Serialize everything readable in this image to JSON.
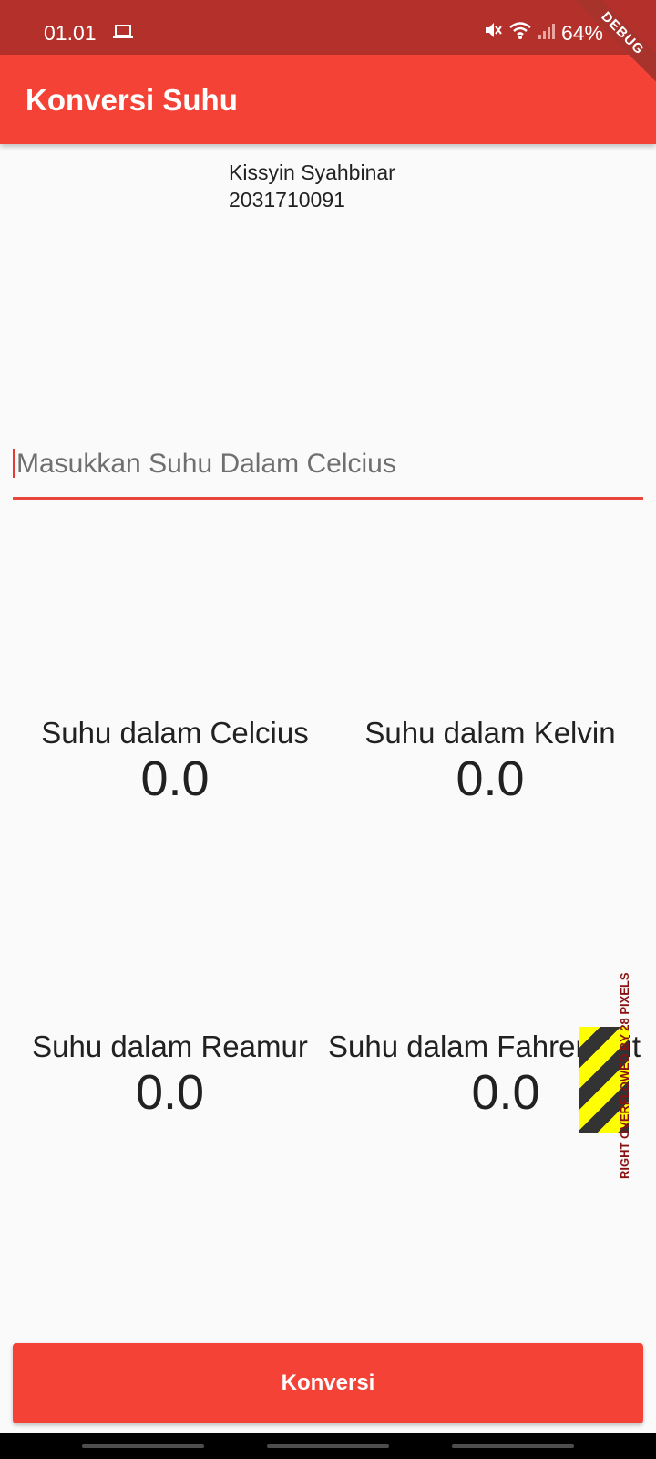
{
  "status_bar": {
    "time": "01.01",
    "battery": "64%",
    "debug_banner": "DEBUG"
  },
  "app_bar": {
    "title": "Konversi Suhu"
  },
  "author": {
    "name": "Kissyin Syahbinar",
    "id": "2031710091"
  },
  "input": {
    "placeholder": "Masukkan Suhu Dalam Celcius",
    "value": ""
  },
  "results": {
    "celsius": {
      "label": "Suhu dalam Celcius",
      "value": "0.0"
    },
    "kelvin": {
      "label": "Suhu dalam Kelvin",
      "value": "0.0"
    },
    "reamur": {
      "label": "Suhu dalam Reamur",
      "value": "0.0"
    },
    "fahrenheit": {
      "label": "Suhu dalam Fahrenheit",
      "value": "0.0"
    }
  },
  "overflow_warning": "RIGHT OVERFLOWED BY 28 PIXELS",
  "button": {
    "label": "Konversi"
  },
  "colors": {
    "primary": "#f44336",
    "status_bar": "#b3312a"
  }
}
